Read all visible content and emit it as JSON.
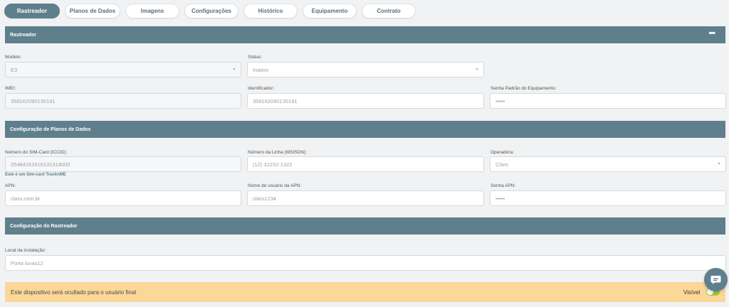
{
  "tabs": [
    {
      "label": "Rastreador",
      "active": true
    },
    {
      "label": "Planos de Dados",
      "active": false
    },
    {
      "label": "Imagens",
      "active": false
    },
    {
      "label": "Configurações",
      "active": false
    },
    {
      "label": "Histórico",
      "active": false
    },
    {
      "label": "Equipamento",
      "active": false
    },
    {
      "label": "Contrato",
      "active": false
    }
  ],
  "sections": {
    "tracker": {
      "title": "Rastreador",
      "menu_icon": "more-horizontal-icon"
    },
    "data_plans": {
      "title": "Configuração de Planos de Dados"
    },
    "tracker_config": {
      "title": "Configuração do Rastreador"
    }
  },
  "fields": {
    "model": {
      "label": "Modelo:",
      "value": "E3"
    },
    "status": {
      "label": "Status:",
      "value": "Inativo"
    },
    "imei": {
      "label": "IMEI:",
      "value": "358162090135191"
    },
    "identifier": {
      "label": "Identificador:",
      "value": "358162090135191"
    },
    "default_password": {
      "label": "Senha Padrão do Equipamento:",
      "value": "•••••"
    },
    "sim_card": {
      "label": "Número do SIM-Card (ICCID):",
      "value": "25484161616131314000",
      "hint": "Este é um Sim-card TracknME"
    },
    "line_number": {
      "label": "Número da Linha (MSISDN):",
      "value": "(12) 32232-1322"
    },
    "carrier": {
      "label": "Operadora:",
      "value": "Claro"
    },
    "apn": {
      "label": "APN:",
      "value": "claro.com.br"
    },
    "apn_user": {
      "label": "Nome de usuário da APN:",
      "value": "claro1234"
    },
    "apn_password": {
      "label": "Senha APN:",
      "value": "•••••"
    },
    "install_location": {
      "label": "Local da instalação:",
      "value": "Porta luvas12"
    }
  },
  "warning": {
    "message": "Este dispositivo será ocultado para o usuário final",
    "visible_label": "Visível",
    "visible_on": true
  },
  "chat": {
    "icon": "chat-icon"
  },
  "colors": {
    "accent": "#5f7f8c",
    "warning_bg": "#fbd798",
    "toggle_on": "#9ccc3c"
  }
}
